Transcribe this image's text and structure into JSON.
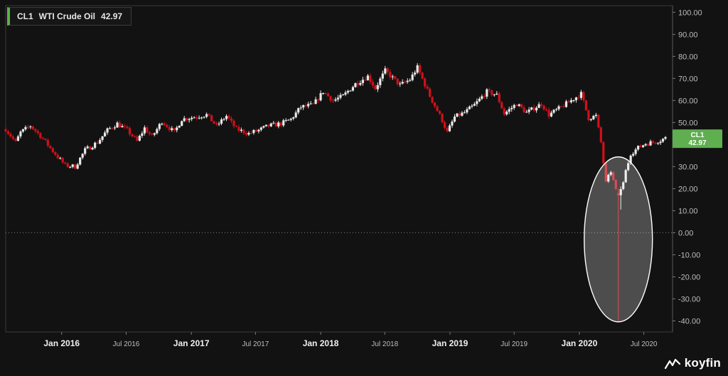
{
  "legend": {
    "symbol": "CL1",
    "name": "WTI Crude Oil",
    "value": "42.97"
  },
  "price_tag": {
    "symbol": "CL1",
    "value": "42.97"
  },
  "brand": {
    "name": "koyfin"
  },
  "colors": {
    "background": "#121212",
    "up": "#e8e8e8",
    "down": "#d0101a",
    "tag": "#5fae4f",
    "zero_line": "#7a7a7a",
    "axis": "#bdbdbd",
    "highlight_ellipse": "rgba(255,255,255,0.25)"
  },
  "chart_data": {
    "type": "candlestick",
    "title": "WTI Crude Oil",
    "series": [
      {
        "name": "CL1"
      }
    ],
    "y_range": [
      -45,
      103
    ],
    "y_ticks": [
      "100.00",
      "90.00",
      "80.00",
      "70.00",
      "60.00",
      "50.00",
      "40.00",
      "30.00",
      "20.00",
      "10.00",
      "0.00",
      "-10.00",
      "-20.00",
      "-30.00",
      "-40.00"
    ],
    "y_tick_values": [
      100,
      90,
      80,
      70,
      60,
      50,
      40,
      30,
      20,
      10,
      0,
      -10,
      -20,
      -30,
      -40
    ],
    "x_ticks": [
      {
        "date": "2016-01-01",
        "label": "Jan 2016",
        "bold": true
      },
      {
        "date": "2016-07-01",
        "label": "Jul 2016",
        "bold": false
      },
      {
        "date": "2017-01-01",
        "label": "Jan 2017",
        "bold": true
      },
      {
        "date": "2017-07-01",
        "label": "Jul 2017",
        "bold": false
      },
      {
        "date": "2018-01-01",
        "label": "Jan 2018",
        "bold": true
      },
      {
        "date": "2018-07-01",
        "label": "Jul 2018",
        "bold": false
      },
      {
        "date": "2019-01-01",
        "label": "Jan 2019",
        "bold": true
      },
      {
        "date": "2019-07-01",
        "label": "Jul 2019",
        "bold": false
      },
      {
        "date": "2020-01-01",
        "label": "Jan 2020",
        "bold": true
      },
      {
        "date": "2020-07-01",
        "label": "Jul 2020",
        "bold": false
      }
    ],
    "x_range": [
      "2015-07-27",
      "2020-08-31"
    ],
    "zero_line": {
      "value": 0,
      "style": "dotted"
    },
    "last_value": 42.97,
    "highlight": {
      "center_date": "2020-04-20",
      "center_value": -3,
      "note": "ellipse around April 2020 negative price"
    },
    "close_path": [
      [
        "2015-07-27",
        47.0
      ],
      [
        "2015-08-24",
        41.0
      ],
      [
        "2015-09-07",
        45.5
      ],
      [
        "2015-10-05",
        48.5
      ],
      [
        "2015-11-02",
        44.0
      ],
      [
        "2015-12-07",
        37.0
      ],
      [
        "2016-01-11",
        30.5
      ],
      [
        "2016-02-08",
        30.0
      ],
      [
        "2016-03-07",
        37.5
      ],
      [
        "2016-04-11",
        41.0
      ],
      [
        "2016-05-09",
        46.5
      ],
      [
        "2016-06-06",
        49.5
      ],
      [
        "2016-07-04",
        46.5
      ],
      [
        "2016-08-01",
        41.5
      ],
      [
        "2016-08-22",
        47.5
      ],
      [
        "2016-09-12",
        43.5
      ],
      [
        "2016-10-10",
        50.5
      ],
      [
        "2016-11-14",
        45.5
      ],
      [
        "2016-12-05",
        51.5
      ],
      [
        "2017-01-09",
        52.5
      ],
      [
        "2017-02-13",
        53.5
      ],
      [
        "2017-03-13",
        48.5
      ],
      [
        "2017-04-10",
        53.0
      ],
      [
        "2017-05-08",
        47.0
      ],
      [
        "2017-06-12",
        45.0
      ],
      [
        "2017-07-10",
        46.5
      ],
      [
        "2017-08-07",
        48.5
      ],
      [
        "2017-09-11",
        49.5
      ],
      [
        "2017-10-09",
        51.5
      ],
      [
        "2017-11-06",
        57.0
      ],
      [
        "2017-12-11",
        58.0
      ],
      [
        "2018-01-08",
        64.0
      ],
      [
        "2018-02-05",
        60.0
      ],
      [
        "2018-03-05",
        62.0
      ],
      [
        "2018-04-09",
        67.5
      ],
      [
        "2018-05-14",
        71.0
      ],
      [
        "2018-06-04",
        65.5
      ],
      [
        "2018-07-02",
        73.5
      ],
      [
        "2018-08-13",
        67.0
      ],
      [
        "2018-09-10",
        69.5
      ],
      [
        "2018-10-01",
        75.0
      ],
      [
        "2018-11-05",
        62.0
      ],
      [
        "2018-12-10",
        51.0
      ],
      [
        "2018-12-24",
        45.5
      ],
      [
        "2019-01-14",
        52.5
      ],
      [
        "2019-02-11",
        54.5
      ],
      [
        "2019-03-11",
        58.0
      ],
      [
        "2019-04-15",
        64.0
      ],
      [
        "2019-05-13",
        62.5
      ],
      [
        "2019-06-03",
        54.0
      ],
      [
        "2019-07-08",
        58.5
      ],
      [
        "2019-08-05",
        54.5
      ],
      [
        "2019-09-16",
        58.5
      ],
      [
        "2019-10-07",
        53.5
      ],
      [
        "2019-11-11",
        57.0
      ],
      [
        "2019-12-09",
        60.0
      ],
      [
        "2020-01-06",
        63.0
      ],
      [
        "2020-01-27",
        52.0
      ],
      [
        "2020-02-17",
        53.0
      ],
      [
        "2020-03-02",
        41.0
      ],
      [
        "2020-03-16",
        22.5
      ],
      [
        "2020-03-30",
        28.0
      ],
      [
        "2020-04-13",
        19.0
      ],
      [
        "2020-04-20",
        17.0
      ],
      [
        "2020-04-27",
        18.0
      ],
      [
        "2020-05-11",
        28.0
      ],
      [
        "2020-05-25",
        36.0
      ],
      [
        "2020-06-15",
        38.5
      ],
      [
        "2020-07-06",
        40.5
      ],
      [
        "2020-07-27",
        41.0
      ],
      [
        "2020-08-17",
        42.0
      ],
      [
        "2020-08-31",
        42.97
      ]
    ],
    "notable_bars": [
      {
        "date": "2020-04-20",
        "open": 18.0,
        "high": 20.0,
        "low": -40.3,
        "close": 17.0
      },
      {
        "date": "2020-04-27",
        "open": 17.0,
        "high": 21.0,
        "low": 10.5,
        "close": 19.8
      }
    ]
  }
}
